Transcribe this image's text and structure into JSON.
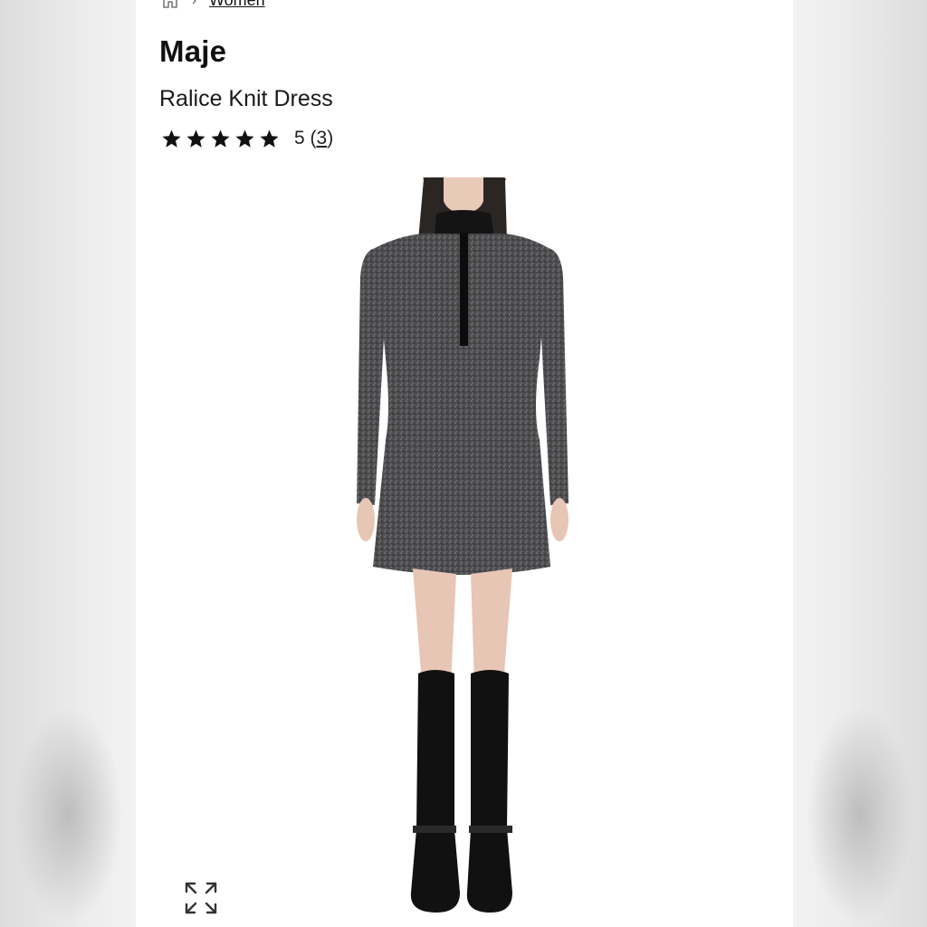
{
  "breadcrumb": {
    "home_icon": "home-icon",
    "separator": "›",
    "current": "Women"
  },
  "product": {
    "brand": "Maje",
    "name": "Ralice Knit Dress",
    "rating": {
      "stars": 5,
      "value": "5",
      "count": "3"
    },
    "image": "product-photo-model-in-grey-knit-dress-and-black-boots"
  },
  "controls": {
    "expand_icon": "expand-icon"
  },
  "colors": {
    "panel": "#ffffff",
    "background": "#e9e9e9",
    "dress": "#4a4a4c",
    "boots": "#111111"
  }
}
